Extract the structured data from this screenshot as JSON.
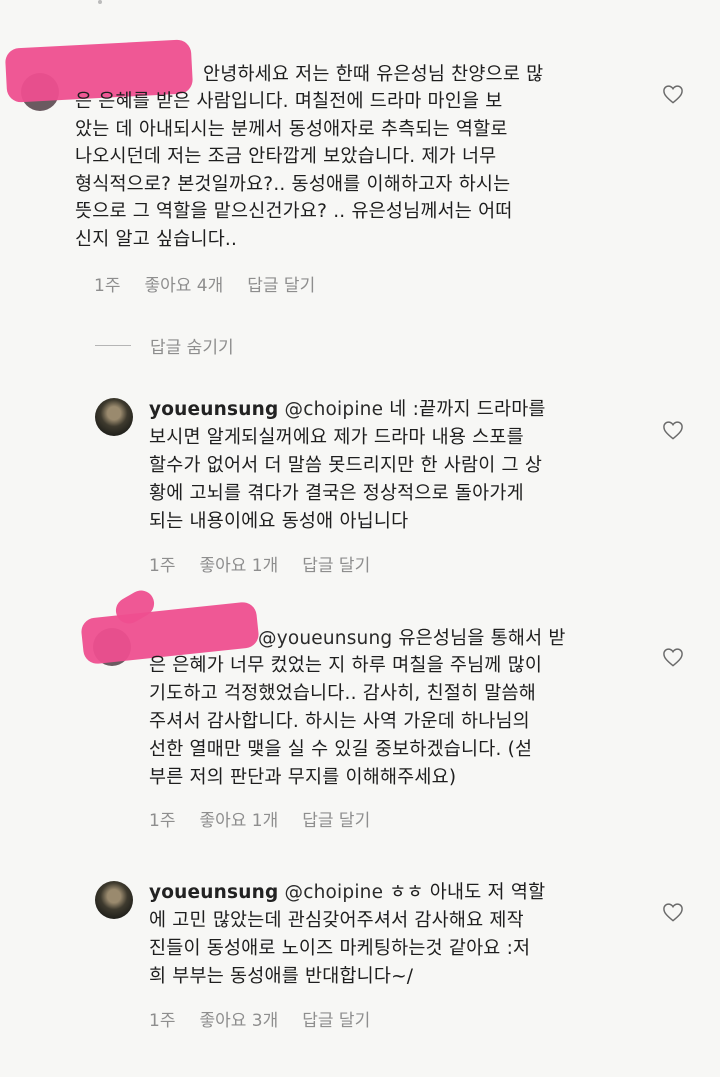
{
  "comments": [
    {
      "username": "",
      "mention": "",
      "lines": [
        "안녕하세요 저는 한때 유은성님 찬양으로 많",
        "은 은혜를 받은 사람입니다. 며칠전에 드라마 마인을 보",
        "았는 데 아내되시는 분께서 동성애자로 추측되는 역할로",
        "나오시던데 저는 조금 안타깝게 보았습니다. 제가 너무",
        "형식적으로? 본것일까요?.. 동성애를 이해하고자 하시는",
        "뜻으로 그 역할을 맡으신건가요? .. 유은성님께서는 어떠",
        "신지 알고 싶습니다.."
      ],
      "time": "1주",
      "likes": "좋아요 4개",
      "reply": "답글 달기"
    },
    {
      "username": "youeunsung",
      "mention": "@choipine",
      "lines": [
        "네 :끝까지 드라마를",
        "보시면 알게되실꺼에요 제가 드라마 내용 스포를",
        "할수가 없어서 더 말씀 못드리지만 한 사람이 그 상",
        "황에 고뇌를 겪다가 결국은 정상적으로 돌아가게",
        "되는 내용이에요 동성애 아닙니다"
      ],
      "time": "1주",
      "likes": "좋아요 1개",
      "reply": "답글 달기"
    },
    {
      "username": "",
      "mention": "@youeunsung",
      "lines": [
        "유은성님을 통해서 받",
        "은 은혜가 너무 컸었는 지 하루 며칠을 주님께 많이",
        "기도하고 걱정했었습니다.. 감사히, 친절히 말씀해",
        "주셔서 감사합니다. 하시는 사역 가운데 하나님의",
        "선한 열매만 맺을 실 수 있길 중보하겠습니다. (섣",
        "부른 저의 판단과 무지를 이해해주세요)"
      ],
      "time": "1주",
      "likes": "좋아요 1개",
      "reply": "답글 달기"
    },
    {
      "username": "youeunsung",
      "mention": "@choipine",
      "lines": [
        "ㅎㅎ 아내도 저 역할",
        "에 고민 많았는데 관심갖어주셔서 감사해요 제작",
        "진들이 동성애로 노이즈 마케팅하는것 같아요 :저",
        "희 부부는 동성애를 반대합니다~/"
      ],
      "time": "1주",
      "likes": "좋아요 3개",
      "reply": "답글 달기"
    }
  ],
  "hide_replies": "답글 숨기기",
  "colors": {
    "redaction": "#ee4f8f",
    "meta": "#8e8e8e",
    "background": "#f7f7f5"
  },
  "icons": {
    "like": "heart-outline-icon"
  }
}
